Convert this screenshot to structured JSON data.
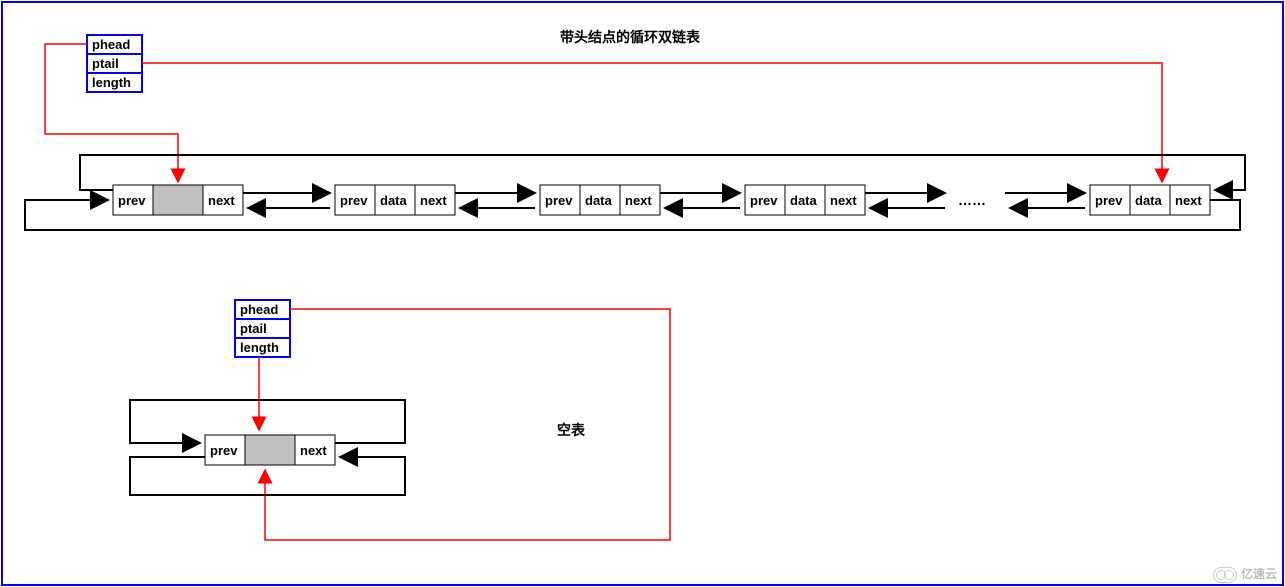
{
  "title": "带头结点的循环双链表",
  "empty_list_label": "空表",
  "struct_top": {
    "fields": [
      "phead",
      "ptail",
      "length"
    ]
  },
  "struct_bottom": {
    "fields": [
      "phead",
      "ptail",
      "length"
    ]
  },
  "node_fields": {
    "prev": "prev",
    "data": "data",
    "next": "next"
  },
  "ellipsis": "……",
  "watermark": "亿速云",
  "colors": {
    "frame": "#0000ff",
    "pointer": "#ff0000",
    "node": "#000000",
    "shaded": "#c0c0c0"
  },
  "chart_data": {
    "type": "diagram",
    "description": "Circular doubly-linked list with header (sentinel) node",
    "top_diagram": {
      "list_object": [
        "phead",
        "ptail",
        "length"
      ],
      "nodes": [
        {
          "role": "head",
          "cells": [
            "prev",
            "(shaded/no data)",
            "next"
          ]
        },
        {
          "role": "element",
          "cells": [
            "prev",
            "data",
            "next"
          ]
        },
        {
          "role": "element",
          "cells": [
            "prev",
            "data",
            "next"
          ]
        },
        {
          "role": "element",
          "cells": [
            "prev",
            "data",
            "next"
          ]
        },
        {
          "role": "ellipsis"
        },
        {
          "role": "element",
          "cells": [
            "prev",
            "data",
            "next"
          ]
        }
      ],
      "pointers": [
        {
          "from": "list.phead",
          "to": "head-node"
        },
        {
          "from": "list.ptail",
          "to": "last-node"
        },
        {
          "between_adjacent_nodes": "bidirectional next/prev arrows"
        },
        {
          "from": "head.prev",
          "to": "last-node",
          "via": "wrap-around top"
        },
        {
          "from": "last.next",
          "to": "head-node",
          "via": "wrap-around bottom"
        }
      ]
    },
    "bottom_diagram": {
      "label": "空表",
      "list_object": [
        "phead",
        "ptail",
        "length"
      ],
      "nodes": [
        {
          "role": "head",
          "cells": [
            "prev",
            "(shaded/no data)",
            "next"
          ]
        }
      ],
      "pointers": [
        {
          "from": "list.phead",
          "to": "head-node"
        },
        {
          "from": "list.ptail",
          "to": "head-node"
        },
        {
          "from": "head.prev",
          "to": "head-node (self)"
        },
        {
          "from": "head.next",
          "to": "head-node (self)"
        }
      ]
    }
  }
}
